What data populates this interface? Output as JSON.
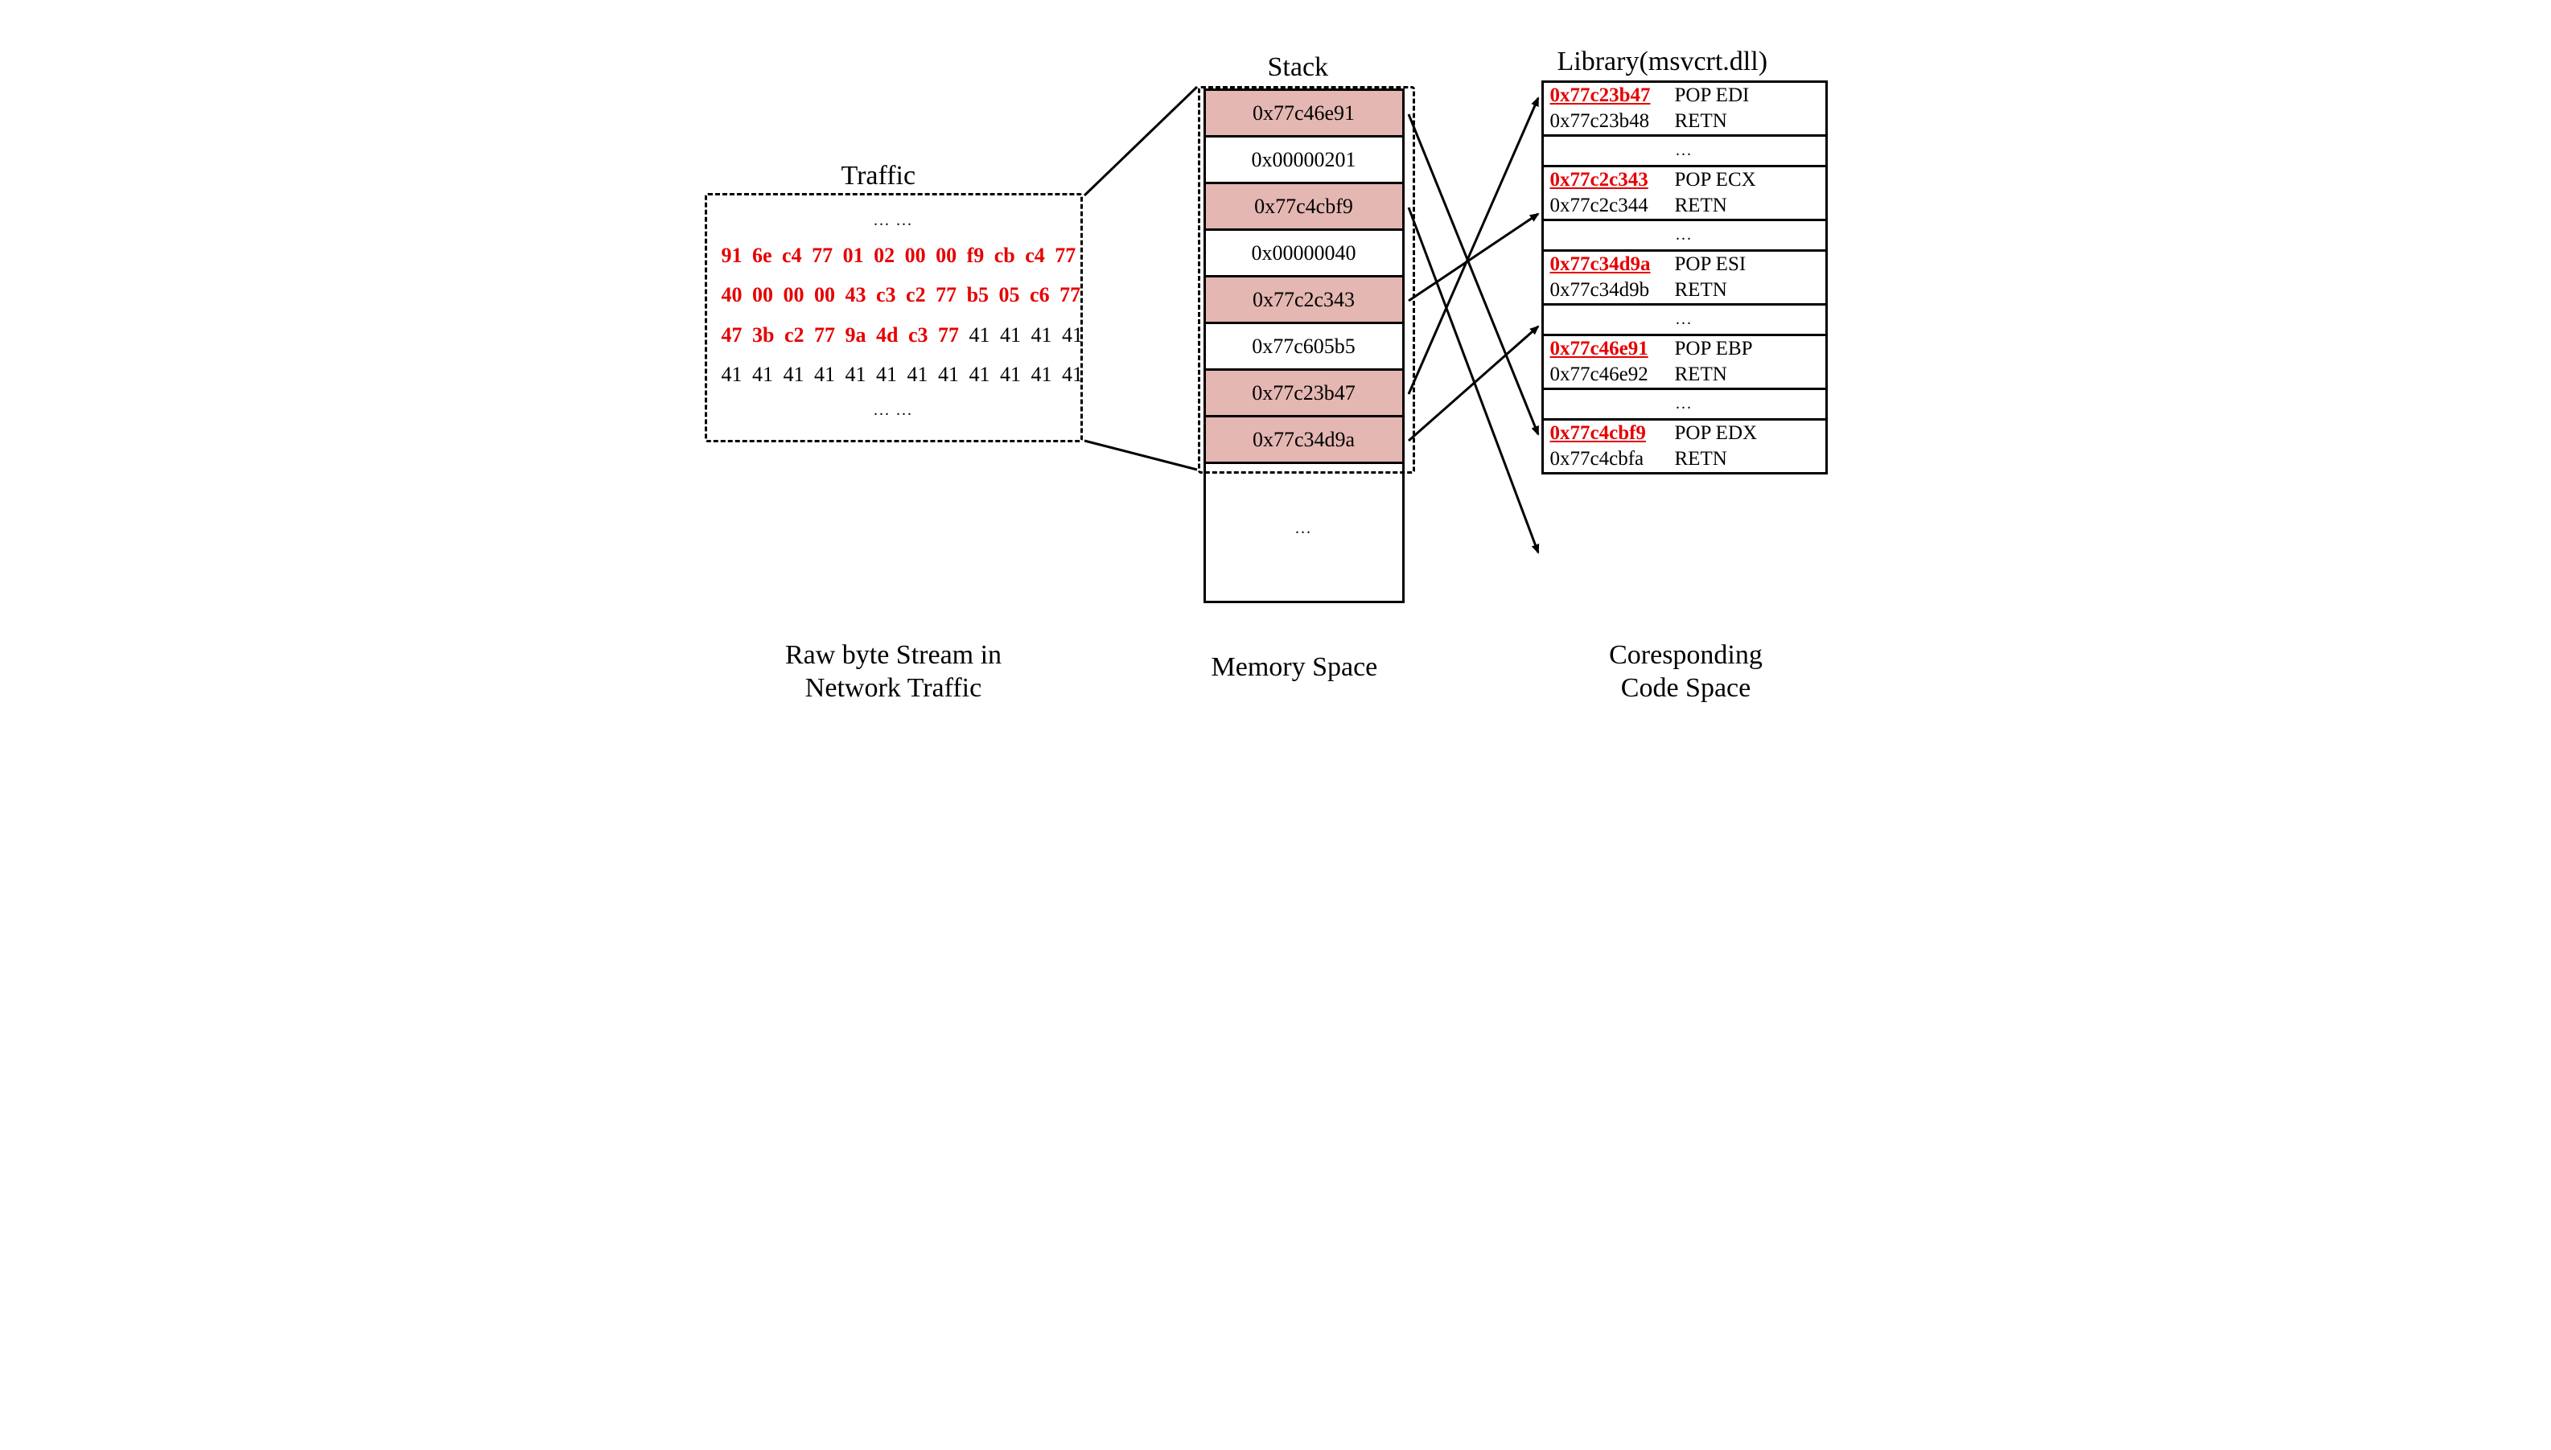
{
  "titles": {
    "traffic": "Traffic",
    "stack": "Stack",
    "library": "Library(msvcrt.dll)"
  },
  "captions": {
    "left1": "Raw byte Stream in",
    "left2": "Network Traffic",
    "mid": "Memory Space",
    "right1": "Coresponding",
    "right2": "Code Space"
  },
  "traffic": {
    "dots": "... ...",
    "line1_red": "91 6e c4 77 01 02 00 00 f9 cb c4 77",
    "line2_red": "40 00 00 00 43 c3 c2 77 b5 05 c6 77",
    "line3_red": "47 3b c2 77 9a 4d c3 77",
    "line3_blk": " 41 41 41 41",
    "line4_blk": "41 41 41 41 41 41 41 41 41 41 41 41",
    "dots2": "... ..."
  },
  "stack": [
    {
      "text": "0x77c46e91",
      "hl": true
    },
    {
      "text": "0x00000201",
      "hl": false
    },
    {
      "text": "0x77c4cbf9",
      "hl": true
    },
    {
      "text": "0x00000040",
      "hl": false
    },
    {
      "text": "0x77c2c343",
      "hl": true
    },
    {
      "text": "0x77c605b5",
      "hl": false
    },
    {
      "text": "0x77c23b47",
      "hl": true
    },
    {
      "text": "0x77c34d9a",
      "hl": true
    }
  ],
  "stack_dots": "...",
  "library": [
    {
      "type": "block",
      "rows": [
        {
          "addr": "0x77c23b47",
          "instr": "POP EDI",
          "hl": true
        },
        {
          "addr": "0x77c23b48",
          "instr": "RETN",
          "hl": false
        }
      ]
    },
    {
      "type": "dots",
      "text": "..."
    },
    {
      "type": "block",
      "rows": [
        {
          "addr": "0x77c2c343",
          "instr": "POP ECX",
          "hl": true
        },
        {
          "addr": "0x77c2c344",
          "instr": "RETN",
          "hl": false
        }
      ]
    },
    {
      "type": "dots",
      "text": "..."
    },
    {
      "type": "block",
      "rows": [
        {
          "addr": "0x77c34d9a",
          "instr": "POP ESI",
          "hl": true
        },
        {
          "addr": "0x77c34d9b",
          "instr": "RETN",
          "hl": false
        }
      ]
    },
    {
      "type": "dots",
      "text": "..."
    },
    {
      "type": "block",
      "rows": [
        {
          "addr": "0x77c46e91",
          "instr": "POP EBP",
          "hl": true
        },
        {
          "addr": "0x77c46e92",
          "instr": "RETN",
          "hl": false
        }
      ]
    },
    {
      "type": "dots",
      "text": "..."
    },
    {
      "type": "block",
      "rows": [
        {
          "addr": "0x77c4cbf9",
          "instr": "POP EDX",
          "hl": true
        },
        {
          "addr": "0x77c4cbfa",
          "instr": "RETN",
          "hl": false
        }
      ]
    }
  ]
}
